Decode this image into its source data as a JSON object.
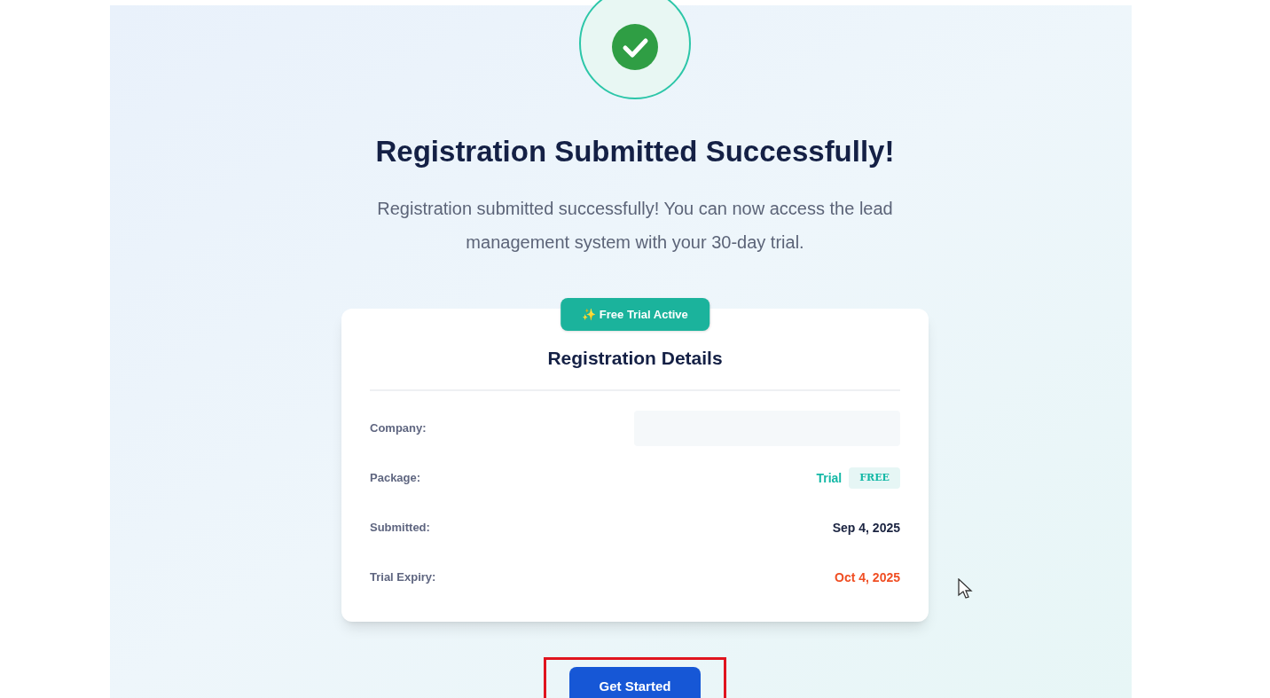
{
  "title": "Registration Submitted Successfully!",
  "message": "Registration submitted successfully! You can now access the lead management system with your 30-day trial.",
  "card": {
    "badge": "✨ Free Trial Active",
    "title": "Registration Details",
    "rows": [
      {
        "kind": "empty",
        "label": "Company:"
      },
      {
        "kind": "package",
        "label": "Package:",
        "value": "Trial",
        "tag": "FREE"
      },
      {
        "kind": "plain",
        "label": "Submitted:",
        "value": "Sep 4, 2025"
      },
      {
        "kind": "warning",
        "label": "Trial Expiry:",
        "value": "Oct 4, 2025"
      }
    ]
  },
  "button": {
    "label": "Get Started",
    "highlighted": true
  }
}
